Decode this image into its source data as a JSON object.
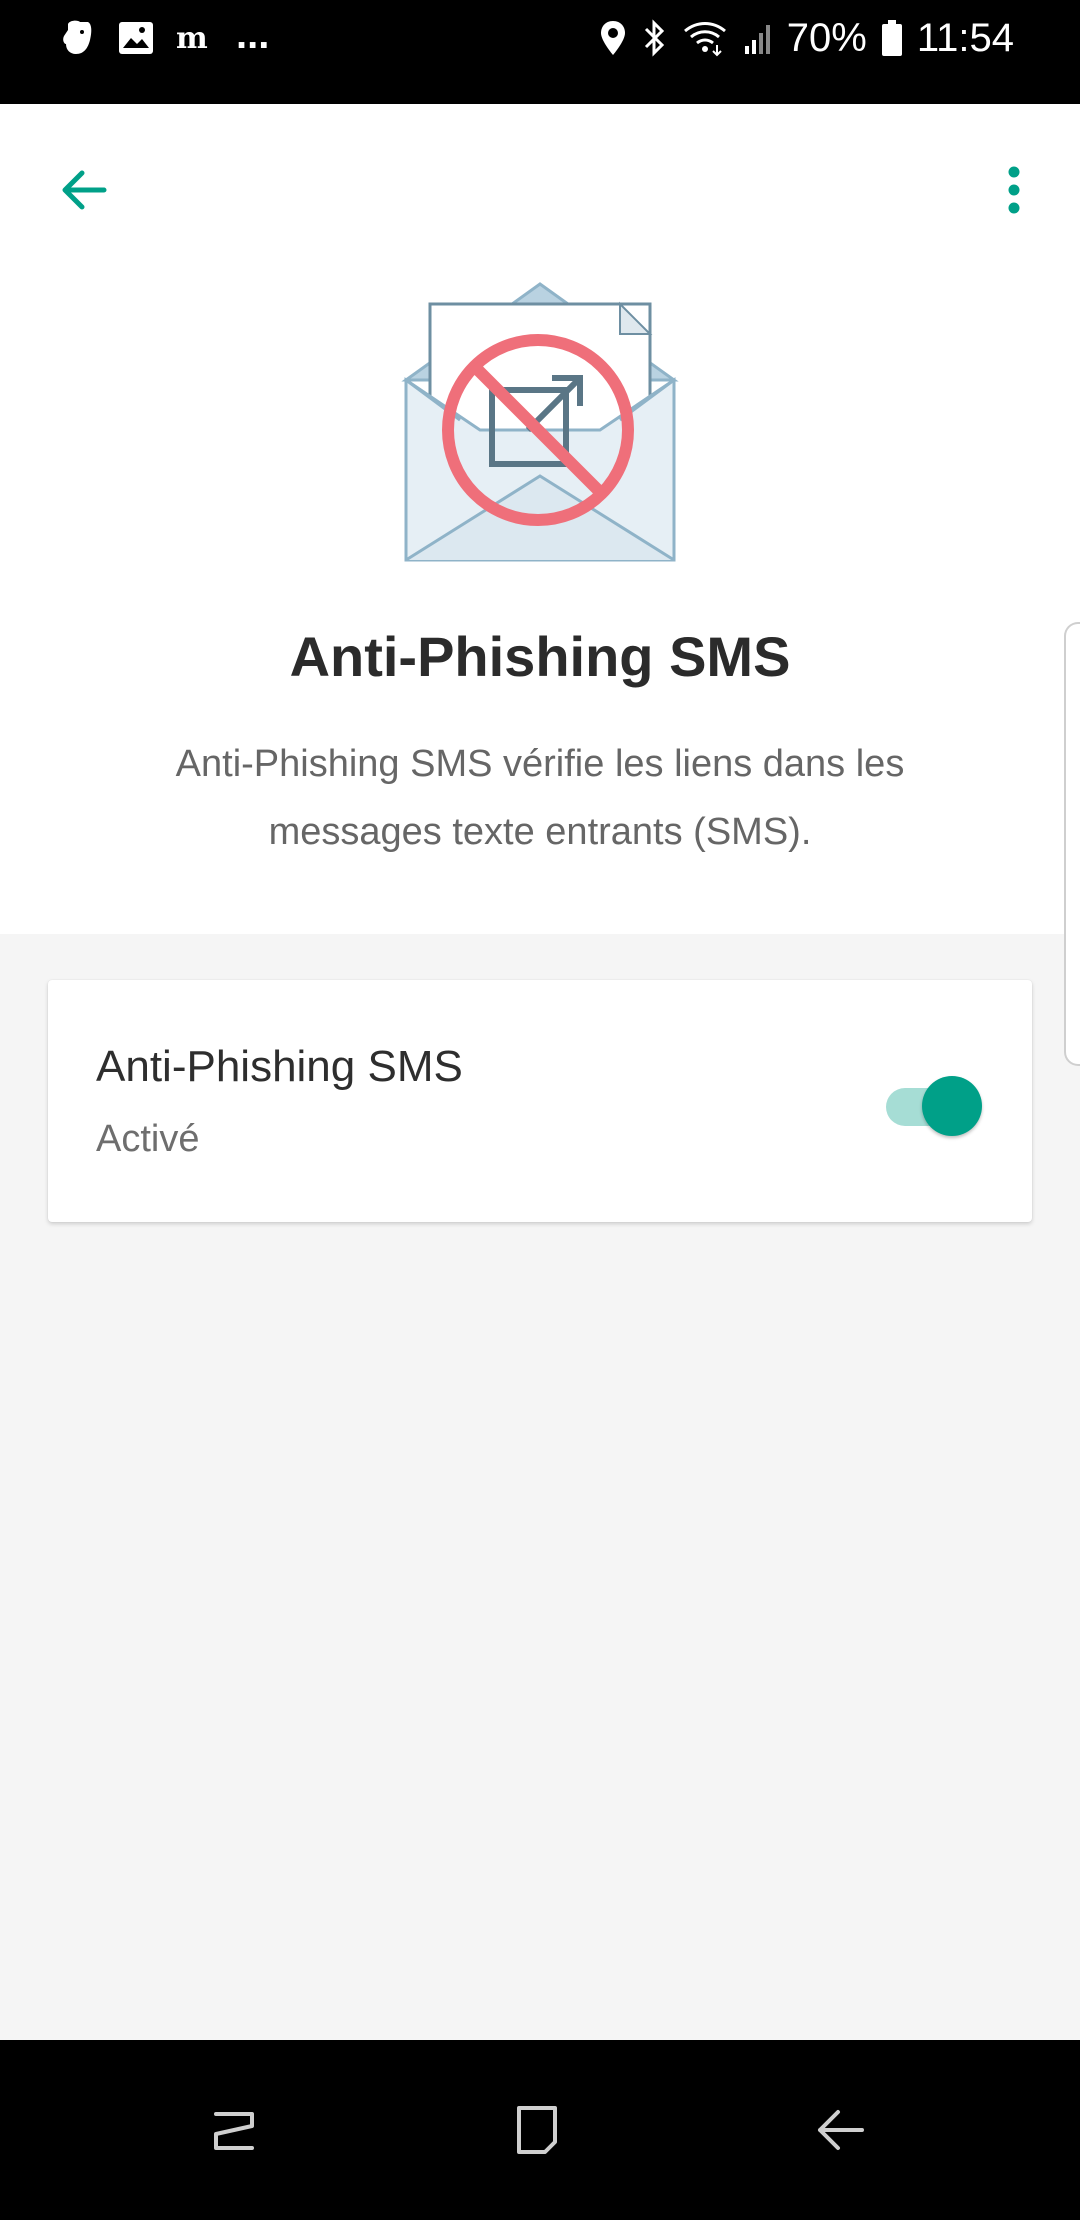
{
  "status_bar": {
    "battery": "70%",
    "time": "11:54",
    "left_icons": [
      "evernote-icon",
      "image-icon",
      "le-monde-icon"
    ],
    "overflow": "...",
    "right_icons": [
      "location-icon",
      "bluetooth-icon",
      "wifi-icon",
      "signal-icon",
      "battery-icon"
    ]
  },
  "header": {
    "back_icon": "arrow-left-icon",
    "menu_icon": "more-vert-icon"
  },
  "feature": {
    "title": "Anti-Phishing SMS",
    "description": "Anti-Phishing SMS vérifie les liens dans les messages texte entrants (SMS).",
    "illustration": "envelope-with-blocked-link-icon"
  },
  "setting_card": {
    "title": "Anti-Phishing SMS",
    "status": "Activé",
    "enabled": true
  },
  "nav_bar": {
    "items": [
      "recent-apps-icon",
      "home-icon",
      "back-icon"
    ]
  },
  "colors": {
    "accent": "#00a088",
    "accent_light": "#a6ddd5",
    "no_sign": "#ef6f7a",
    "background": "#f5f5f5"
  }
}
